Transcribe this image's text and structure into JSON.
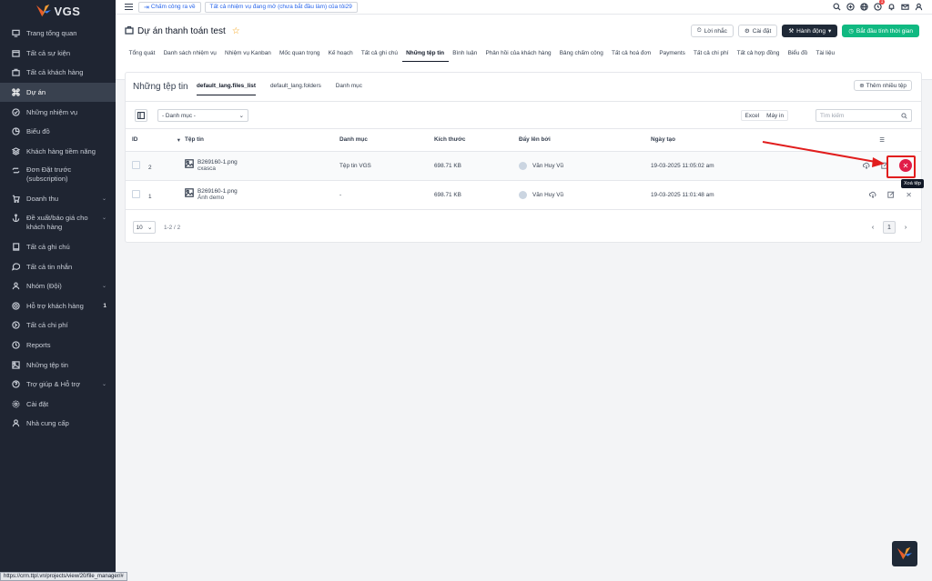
{
  "brand": {
    "name": "VGS"
  },
  "sidebar": {
    "items": [
      {
        "label": "Trang tổng quan",
        "icon": "monitor-icon"
      },
      {
        "label": "Tất cả sự kiện",
        "icon": "calendar-icon"
      },
      {
        "label": "Tất cả khách hàng",
        "icon": "briefcase-icon"
      },
      {
        "label": "Dự án",
        "icon": "command-icon",
        "active": true
      },
      {
        "label": "Những nhiệm vụ",
        "icon": "check-circle-icon"
      },
      {
        "label": "Biểu đồ",
        "icon": "pie-chart-icon"
      },
      {
        "label": "Khách hàng tiềm năng",
        "icon": "layers-icon"
      },
      {
        "label": "Đơn Đặt trước (subscription)",
        "icon": "repeat-icon",
        "tall": true
      },
      {
        "label": "Doanh thu",
        "icon": "cart-icon",
        "caret": true
      },
      {
        "label": "Đề xuất/báo giá cho khách hàng",
        "icon": "anchor-icon",
        "caret": true,
        "tall": true
      },
      {
        "label": "Tất cả ghi chú",
        "icon": "book-icon"
      },
      {
        "label": "Tất cả tin nhắn",
        "icon": "message-icon"
      },
      {
        "label": "Nhóm (Đội)",
        "icon": "users-icon",
        "caret": true
      },
      {
        "label": "Hỗ trợ khách hàng",
        "icon": "lifebuoy-icon",
        "badge": "1"
      },
      {
        "label": "Tất cả chi phí",
        "icon": "arrow-circle-icon"
      },
      {
        "label": "Reports",
        "icon": "clock-icon"
      },
      {
        "label": "Những tệp tin",
        "icon": "image-icon"
      },
      {
        "label": "Trợ giúp & Hỗ trợ",
        "icon": "help-icon",
        "caret": true
      },
      {
        "label": "Cài đặt",
        "icon": "settings-icon"
      },
      {
        "label": "Nhà cung cấp",
        "icon": "user-icon"
      }
    ]
  },
  "topbar": {
    "clock_out": "Chấm công ra về",
    "open_tasks": "Tất cả nhiệm vụ đang mở (chưa bắt đầu làm) của tôi29",
    "notif_count": "1"
  },
  "project": {
    "title": "Dự án thanh toán test",
    "actions": {
      "reminder": "Lời nhắc",
      "settings": "Cài đặt",
      "actions": "Hành động",
      "start_timer": "Bắt đầu tính thời gian"
    },
    "tabs": [
      "Tổng quát",
      "Danh sách nhiệm vụ",
      "Nhiệm vụ Kanban",
      "Mốc quan trọng",
      "Kế hoạch",
      "Tất cả ghi chú",
      "Những tệp tin",
      "Bình luận",
      "Phản hồi của khách hàng",
      "Bảng chấm công",
      "Tất cả hoá đơn",
      "Payments",
      "Tất cả chi phí",
      "Tất cả hợp đồng",
      "Biểu đồ",
      "Tài liệu"
    ],
    "active_tab": 6
  },
  "files": {
    "title": "Những tệp tin",
    "subtabs": [
      "default_lang.files_list",
      "default_lang.folders",
      "Danh mục"
    ],
    "add_button": "Thêm nhiều tệp",
    "category_select": "- Danh mục -",
    "excel": "Excel",
    "print": "Máy in",
    "search_placeholder": "Tìm kiếm",
    "columns": [
      "ID",
      "Tệp tin",
      "Danh mục",
      "Kích thước",
      "Đẩy lên bởi",
      "Ngày tạo"
    ],
    "rows": [
      {
        "id": "2",
        "file": "B269160-1.png",
        "desc": "cxasca",
        "category": "Tệp tin VGS",
        "size": "698.71 KB",
        "uploader": "Văn Huy Vũ",
        "created": "19-03-2025 11:05:02 am"
      },
      {
        "id": "1",
        "file": "B269160-1.png",
        "desc": "Ảnh demo",
        "category": "-",
        "size": "698.71 KB",
        "uploader": "Văn Huy Vũ",
        "created": "19-03-2025 11:01:48 am"
      }
    ],
    "tooltip": "Xoá tệp",
    "page_size": "10",
    "page_info": "1-2 / 2",
    "current_page": "1"
  },
  "status_url": "https://crm.ttpl.vn/projects/view/20/file_manager/#",
  "colors": {
    "sidebar_bg": "#1f2532",
    "accent_green": "#10b981",
    "delete_red": "#e11d48",
    "arrow_red": "#e11d1d"
  }
}
